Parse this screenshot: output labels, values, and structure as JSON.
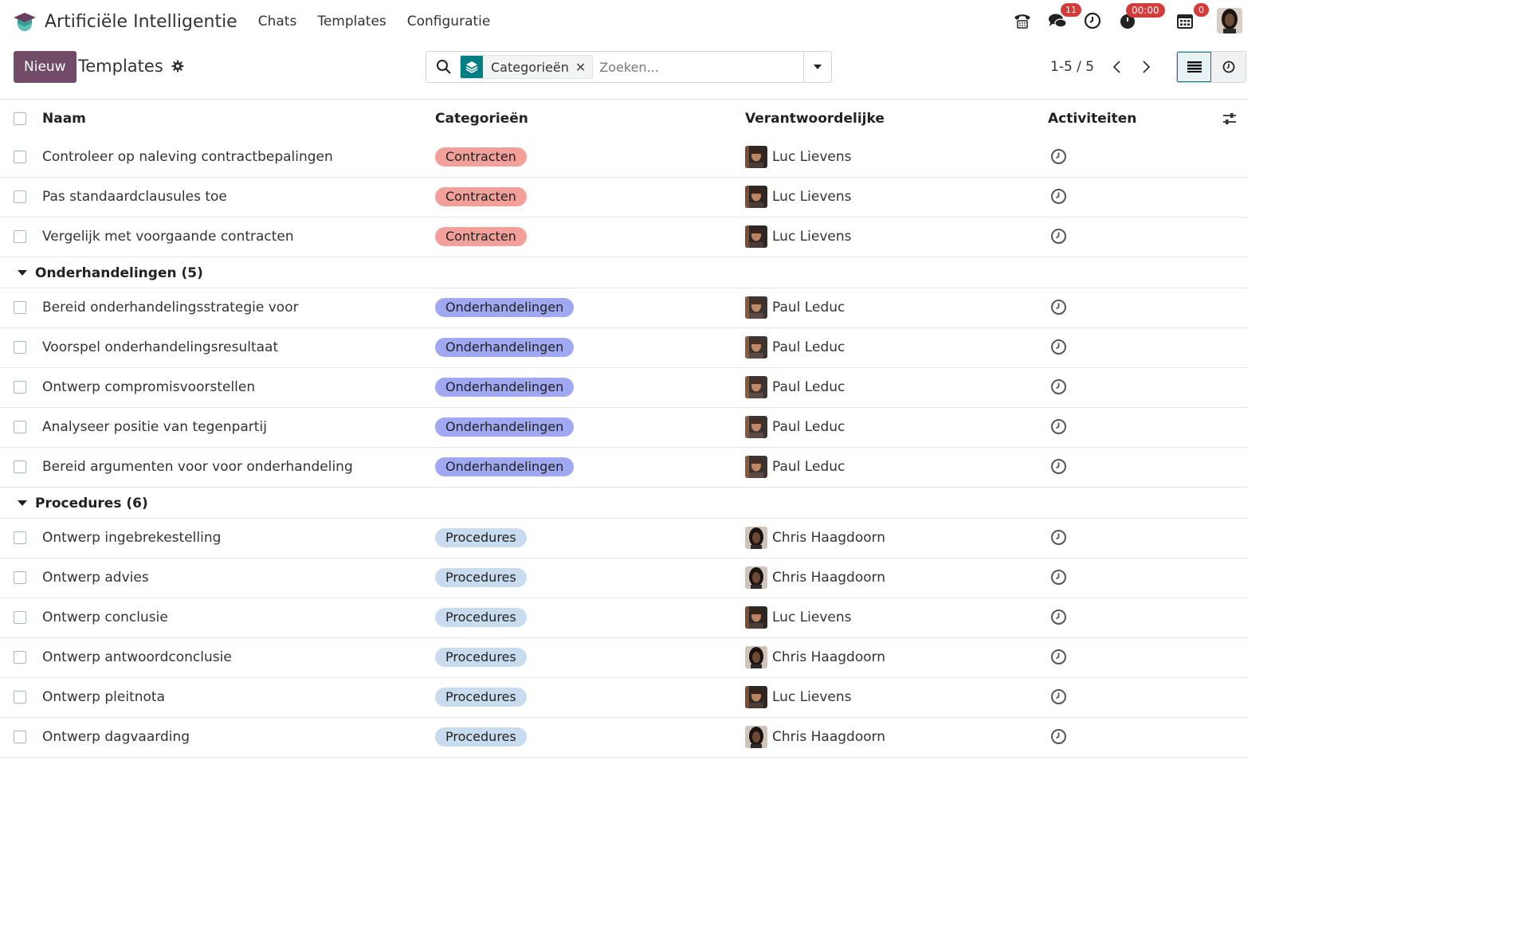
{
  "navbar": {
    "app_name": "Artificiële Intelligentie",
    "menu": [
      "Chats",
      "Templates",
      "Configuratie"
    ],
    "messages_badge": "11",
    "timer": "00:00",
    "calendar_badge": "0"
  },
  "control": {
    "new_button": "Nieuw",
    "title": "Templates",
    "facet_value": "Categorieën",
    "facet_remove": "✕",
    "search_placeholder": "Zoeken...",
    "pager": "1-5 / 5"
  },
  "table": {
    "headers": {
      "name": "Naam",
      "category": "Categorieën",
      "owner": "Verantwoordelijke",
      "activities": "Activiteiten"
    },
    "rows_top": [
      {
        "name": "Controleer op naleving contractbepalingen",
        "tag": "Contracten",
        "owner": "Luc Lievens"
      },
      {
        "name": "Pas standaardclausules toe",
        "tag": "Contracten",
        "owner": "Luc Lievens"
      },
      {
        "name": "Vergelijk met voorgaande contracten",
        "tag": "Contracten",
        "owner": "Luc Lievens"
      }
    ],
    "groups": [
      {
        "label": "Onderhandelingen (5)",
        "rows": [
          {
            "name": "Bereid onderhandelingsstrategie voor",
            "tag": "Onderhandelingen",
            "owner": "Paul Leduc"
          },
          {
            "name": "Voorspel onderhandelingsresultaat",
            "tag": "Onderhandelingen",
            "owner": "Paul Leduc"
          },
          {
            "name": "Ontwerp compromisvoorstellen",
            "tag": "Onderhandelingen",
            "owner": "Paul Leduc"
          },
          {
            "name": "Analyseer positie van tegenpartij",
            "tag": "Onderhandelingen",
            "owner": "Paul Leduc"
          },
          {
            "name": "Bereid argumenten voor voor onderhandeling",
            "tag": "Onderhandelingen",
            "owner": "Paul Leduc"
          }
        ]
      },
      {
        "label": "Procedures (6)",
        "rows": [
          {
            "name": "Ontwerp ingebrekestelling",
            "tag": "Procedures",
            "owner": "Chris Haagdoorn"
          },
          {
            "name": "Ontwerp advies",
            "tag": "Procedures",
            "owner": "Chris Haagdoorn"
          },
          {
            "name": "Ontwerp conclusie",
            "tag": "Procedures",
            "owner": "Luc Lievens"
          },
          {
            "name": "Ontwerp antwoordconclusie",
            "tag": "Procedures",
            "owner": "Chris Haagdoorn"
          },
          {
            "name": "Ontwerp pleitnota",
            "tag": "Procedures",
            "owner": "Luc Lievens"
          },
          {
            "name": "Ontwerp dagvaarding",
            "tag": "Procedures",
            "owner": "Chris Haagdoorn"
          }
        ]
      }
    ]
  },
  "colors": {
    "primary": "#714B67",
    "accent": "#017e84",
    "tag_contracten": "#f4a09a",
    "tag_onderhandelingen": "#9fa8f0",
    "tag_procedures": "#c9dcef"
  }
}
